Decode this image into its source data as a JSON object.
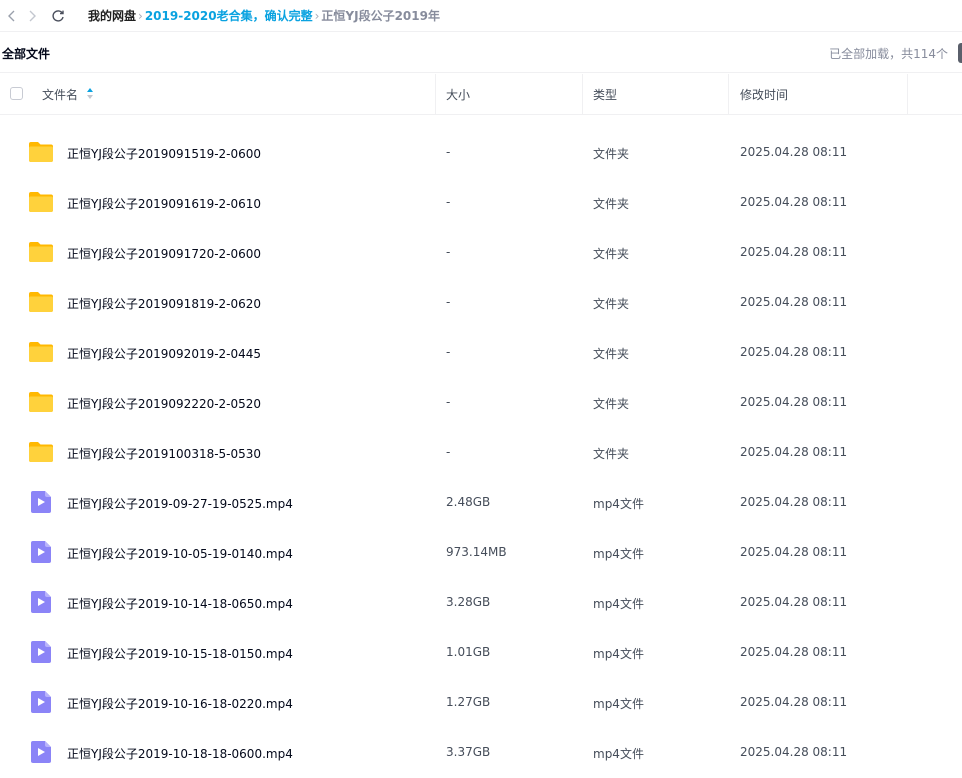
{
  "breadcrumb": {
    "root": "我的网盘",
    "middle": "2019-2020老合集，确认完整",
    "current": "正恒YJ段公子2019年"
  },
  "title_bar": {
    "all_files": "全部文件",
    "loaded_status": "已全部加载，共114个"
  },
  "columns": {
    "name": "文件名",
    "size": "大小",
    "type": "类型",
    "modified": "修改时间"
  },
  "colors": {
    "accent": "#0aa2e0",
    "folder": "#ffc400",
    "video": "#8b84f7"
  },
  "files": [
    {
      "name": "正恒YJ段公子2019091519-2-0600",
      "size": "-",
      "type": "文件夹",
      "modified": "2025.04.28 08:11",
      "icon": "folder-icon"
    },
    {
      "name": "正恒YJ段公子2019091619-2-0610",
      "size": "-",
      "type": "文件夹",
      "modified": "2025.04.28 08:11",
      "icon": "folder-icon"
    },
    {
      "name": "正恒YJ段公子2019091720-2-0600",
      "size": "-",
      "type": "文件夹",
      "modified": "2025.04.28 08:11",
      "icon": "folder-icon"
    },
    {
      "name": "正恒YJ段公子2019091819-2-0620",
      "size": "-",
      "type": "文件夹",
      "modified": "2025.04.28 08:11",
      "icon": "folder-icon"
    },
    {
      "name": "正恒YJ段公子2019092019-2-0445",
      "size": "-",
      "type": "文件夹",
      "modified": "2025.04.28 08:11",
      "icon": "folder-icon"
    },
    {
      "name": "正恒YJ段公子2019092220-2-0520",
      "size": "-",
      "type": "文件夹",
      "modified": "2025.04.28 08:11",
      "icon": "folder-icon"
    },
    {
      "name": "正恒YJ段公子2019100318-5-0530",
      "size": "-",
      "type": "文件夹",
      "modified": "2025.04.28 08:11",
      "icon": "folder-icon"
    },
    {
      "name": "正恒YJ段公子2019-09-27-19-0525.mp4",
      "size": "2.48GB",
      "type": "mp4文件",
      "modified": "2025.04.28 08:11",
      "icon": "video-file-icon"
    },
    {
      "name": "正恒YJ段公子2019-10-05-19-0140.mp4",
      "size": "973.14MB",
      "type": "mp4文件",
      "modified": "2025.04.28 08:11",
      "icon": "video-file-icon"
    },
    {
      "name": "正恒YJ段公子2019-10-14-18-0650.mp4",
      "size": "3.28GB",
      "type": "mp4文件",
      "modified": "2025.04.28 08:11",
      "icon": "video-file-icon"
    },
    {
      "name": "正恒YJ段公子2019-10-15-18-0150.mp4",
      "size": "1.01GB",
      "type": "mp4文件",
      "modified": "2025.04.28 08:11",
      "icon": "video-file-icon"
    },
    {
      "name": "正恒YJ段公子2019-10-16-18-0220.mp4",
      "size": "1.27GB",
      "type": "mp4文件",
      "modified": "2025.04.28 08:11",
      "icon": "video-file-icon"
    },
    {
      "name": "正恒YJ段公子2019-10-18-18-0600.mp4",
      "size": "3.37GB",
      "type": "mp4文件",
      "modified": "2025.04.28 08:11",
      "icon": "video-file-icon"
    }
  ]
}
